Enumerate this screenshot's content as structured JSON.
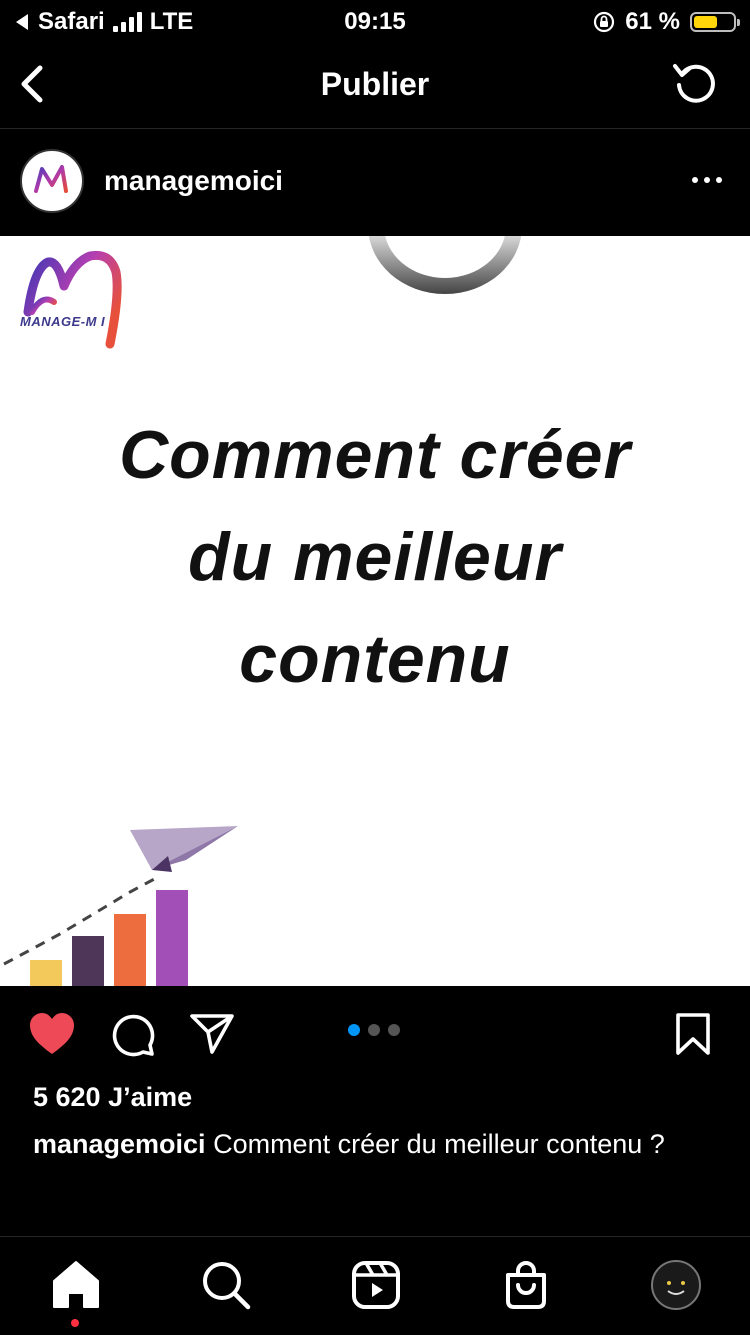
{
  "status_bar": {
    "back_app": "Safari",
    "network": "LTE",
    "time": "09:15",
    "battery_percent": "61 %",
    "battery_level": 0.61
  },
  "nav": {
    "title": "Publier"
  },
  "post": {
    "username": "managemoici",
    "image": {
      "headline_lines": [
        "Comment créer",
        "du meilleur",
        "contenu"
      ],
      "brand_logo_text": "MANAGE-M  I"
    },
    "carousel": {
      "count": 3,
      "active_index": 0
    },
    "likes_text": "5 620 J’aime",
    "caption_username": "managemoici",
    "caption_text": " Comment créer du meilleur contenu ?"
  },
  "colors": {
    "like_red": "#ed4956",
    "active_dot": "#0095f6",
    "battery_yellow": "#ffd60a",
    "notification_dot": "#ff3040"
  },
  "icons": {
    "status": [
      "back-arrow-icon",
      "signal-icon",
      "orientation-lock-icon",
      "battery-icon"
    ],
    "nav": [
      "back-chevron-icon",
      "refresh-icon"
    ],
    "actions": [
      "heart-icon",
      "comment-icon",
      "share-icon",
      "bookmark-icon"
    ],
    "tabs": [
      "home-icon",
      "search-icon",
      "reels-icon",
      "shop-icon",
      "profile-icon"
    ]
  }
}
